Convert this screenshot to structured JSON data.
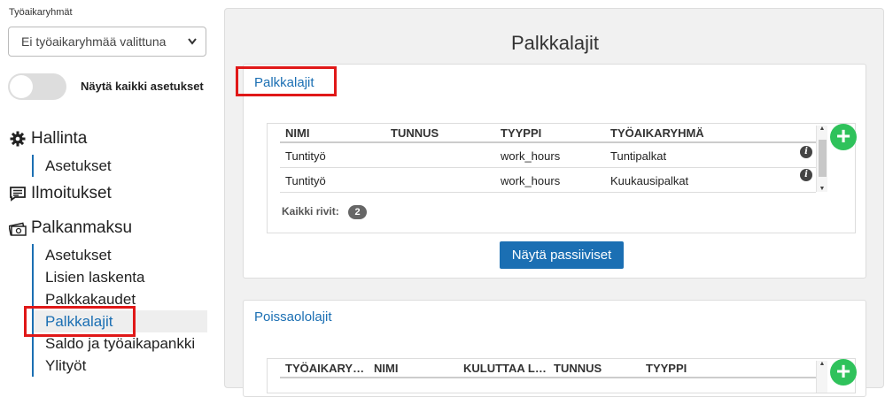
{
  "sidebar": {
    "work_groups_label": "Työaikaryhmät",
    "work_group_select": "Ei työaikaryhmää valittuna",
    "show_all_label": "Näytä kaikki asetukset",
    "sections": [
      {
        "title": "Hallinta",
        "icon": "gear-icon",
        "items": [
          "Asetukset"
        ]
      },
      {
        "title": "Ilmoitukset",
        "icon": "message-icon",
        "items": []
      },
      {
        "title": "Palkanmaksu",
        "icon": "money-icon",
        "items": [
          "Asetukset",
          "Lisien laskenta",
          "Palkkakaudet",
          "Palkkalajit",
          "Saldo ja työaikapankki",
          "Ylityöt"
        ]
      }
    ],
    "active_item": "Palkkalajit"
  },
  "main": {
    "title": "Palkkalajit",
    "pay_types_card": {
      "title": "Palkkalajit",
      "columns": [
        "NIMI",
        "TUNNUS",
        "TYYPPI",
        "TYÖAIKARYHMÄ"
      ],
      "rows": [
        {
          "nimi": "Tuntityö",
          "tunnus": "",
          "tyyppi": "work_hours",
          "tyoaikaryhma": "Tuntipalkat"
        },
        {
          "nimi": "Tuntityö",
          "tunnus": "",
          "tyyppi": "work_hours",
          "tyoaikaryhma": "Kuukausipalkat"
        }
      ],
      "total_label": "Kaikki rivit:",
      "total_count": "2",
      "show_passive_button": "Näytä passiiviset"
    },
    "absence_card": {
      "title": "Poissaololajit",
      "columns": [
        "TYÖAIKARYHMÄ",
        "NIMI",
        "KULUTTAA LOMAPÄIVIÄ",
        "TUNNUS",
        "TYYPPI"
      ]
    }
  },
  "colors": {
    "accent": "#1b6fb3",
    "add": "#2fc25b",
    "highlight": "#e01818"
  }
}
